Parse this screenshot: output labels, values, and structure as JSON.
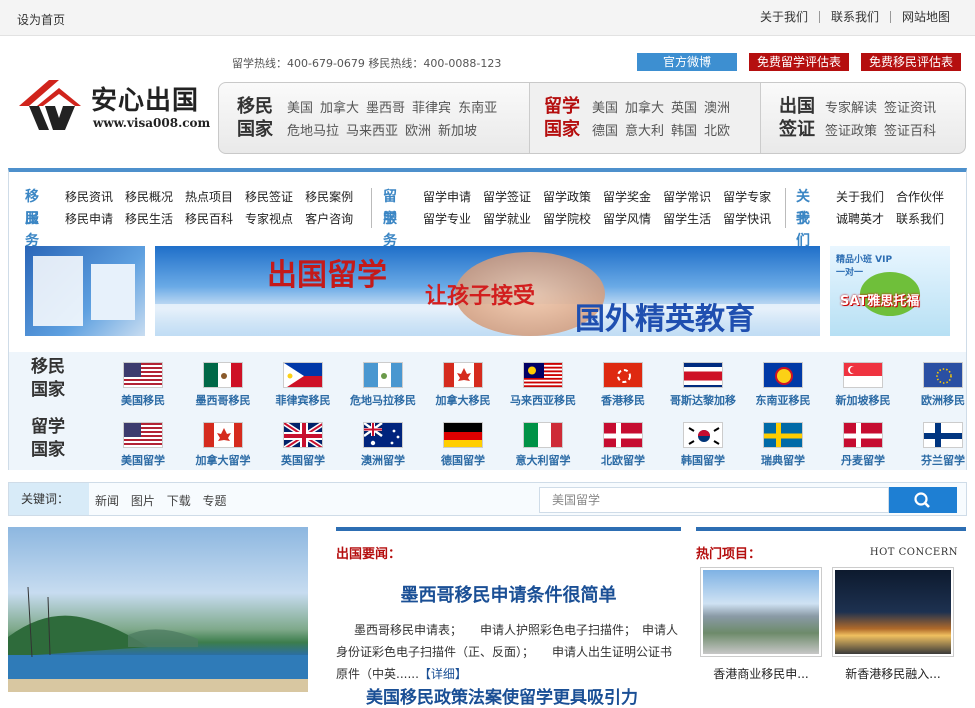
{
  "topbar": {
    "home": "设为首页",
    "links": [
      "关于我们",
      "联系我们",
      "网站地图"
    ]
  },
  "header": {
    "hotlines": "留学热线：400-679-0679 移民热线：400-0088-123",
    "buttons": [
      "官方微博",
      "免费留学评估表",
      "免费移民评估表"
    ],
    "logo_name": "安心出国",
    "logo_url": "www.visa008.com"
  },
  "categories": [
    {
      "line1": "移民",
      "line2": "国家",
      "row1": [
        "美国",
        "加拿大",
        "墨西哥",
        "菲律宾",
        "东南亚"
      ],
      "row2": [
        "危地马拉",
        "马来西亚",
        "欧洲",
        "新加坡"
      ]
    },
    {
      "line1": "留学",
      "line2": "国家",
      "row1": [
        "美国",
        "加拿大",
        "英国",
        "澳洲"
      ],
      "row2": [
        "德国",
        "意大利",
        "韩国",
        "北欧"
      ]
    },
    {
      "line1": "出国",
      "line2": "签证",
      "row1": [
        "专家解读",
        "签证资讯"
      ],
      "row2": [
        "签证政策",
        "签证百科"
      ]
    }
  ],
  "nav": [
    {
      "h1": "移民",
      "h2": "服务",
      "row1": [
        "移民资讯",
        "移民概况",
        "热点项目",
        "移民签证",
        "移民案例"
      ],
      "row2": [
        "移民申请",
        "移民生活",
        "移民百科",
        "专家视点",
        "客户咨询"
      ]
    },
    {
      "h1": "留学",
      "h2": "服务",
      "row1": [
        "留学申请",
        "留学签证",
        "留学政策",
        "留学奖金",
        "留学常识",
        "留学专家"
      ],
      "row2": [
        "留学专业",
        "留学就业",
        "留学院校",
        "留学风情",
        "留学生活",
        "留学快讯"
      ]
    },
    {
      "h1": "关于",
      "h2": "我们",
      "row1": [
        "关于我们",
        "合作伙伴"
      ],
      "row2": [
        "诚聘英才",
        "联系我们"
      ]
    }
  ],
  "banner": {
    "main_title": "出国留学",
    "main_sub": "让孩子接受",
    "main_slogan": "国外精英教育",
    "right_tag": "精品小班 VIP一对一",
    "right_title": "SAT雅思托福"
  },
  "flags": {
    "imm_label": [
      "移民",
      "国家"
    ],
    "study_label": [
      "留学",
      "国家"
    ],
    "imm": [
      {
        "name": "美国移民",
        "flag": "us"
      },
      {
        "name": "墨西哥移民",
        "flag": "mx"
      },
      {
        "name": "菲律宾移民",
        "flag": "ph"
      },
      {
        "name": "危地马拉移民",
        "flag": "gt"
      },
      {
        "name": "加拿大移民",
        "flag": "ca"
      },
      {
        "name": "马来西亚移民",
        "flag": "my"
      },
      {
        "name": "香港移民",
        "flag": "hk"
      },
      {
        "name": "哥斯达黎加移",
        "flag": "cr"
      },
      {
        "name": "东南亚移民",
        "flag": "asean"
      },
      {
        "name": "新加坡移民",
        "flag": "sg"
      },
      {
        "name": "欧洲移民",
        "flag": "eu"
      }
    ],
    "study": [
      {
        "name": "美国留学",
        "flag": "us"
      },
      {
        "name": "加拿大留学",
        "flag": "ca"
      },
      {
        "name": "英国留学",
        "flag": "gb"
      },
      {
        "name": "澳洲留学",
        "flag": "au"
      },
      {
        "name": "德国留学",
        "flag": "de"
      },
      {
        "name": "意大利留学",
        "flag": "it"
      },
      {
        "name": "北欧留学",
        "flag": "dk"
      },
      {
        "name": "韩国留学",
        "flag": "kr"
      },
      {
        "name": "瑞典留学",
        "flag": "se"
      },
      {
        "name": "丹麦留学",
        "flag": "dk"
      },
      {
        "name": "芬兰留学",
        "flag": "fi"
      }
    ]
  },
  "search": {
    "keyword_label": "关键词：",
    "tabs": [
      "新闻",
      "图片",
      "下载",
      "专题"
    ],
    "placeholder": "美国留学"
  },
  "news": {
    "heading": "出国要闻：",
    "title": "墨西哥移民申请条件很简单",
    "body": "墨西哥移民申请表；　　申请人护照彩色电子扫描件；　申请人身份证彩色电子扫描件（正、反面）；　　申请人出生证明公证书原件（中英......",
    "more": "【详细】",
    "title2": "美国移民政策法案使留学更具吸引力"
  },
  "hot": {
    "heading": "热门项目：",
    "en": "HOT CONCERN",
    "items": [
      "香港商业移民申...",
      "新香港移民融入..."
    ]
  },
  "colors": {
    "accent_blue": "#4d90cc",
    "brand_red": "#b50f0f"
  }
}
